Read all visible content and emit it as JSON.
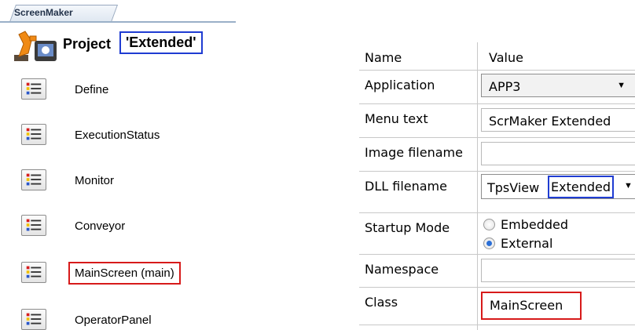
{
  "left_panel": {
    "tab_label": "ScreenMaker",
    "project_prefix": "Project",
    "project_name": "'Extended'",
    "screens": [
      {
        "label": "Define"
      },
      {
        "label": "ExecutionStatus"
      },
      {
        "label": "Monitor"
      },
      {
        "label": "Conveyor"
      },
      {
        "label": "MainScreen (main)"
      },
      {
        "label": "OperatorPanel"
      }
    ]
  },
  "properties": {
    "header_name": "Name",
    "header_value": "Value",
    "rows": [
      {
        "name": "Application"
      },
      {
        "name": "Menu text"
      },
      {
        "name": "Image filename"
      },
      {
        "name": "DLL filename"
      },
      {
        "name": "Startup Mode"
      },
      {
        "name": "Namespace"
      },
      {
        "name": "Class"
      }
    ],
    "application_value": "APP3",
    "menu_text_value": "ScrMaker Extended",
    "dll_prefix": "TpsView",
    "dll_suffix": "Extended",
    "startup_options": [
      "Embedded",
      "External"
    ],
    "startup_selected": "External",
    "class_value": "MainScreen"
  },
  "colors": {
    "highlight_blue": "#1f3cd2",
    "highlight_red": "#d71a1a"
  }
}
